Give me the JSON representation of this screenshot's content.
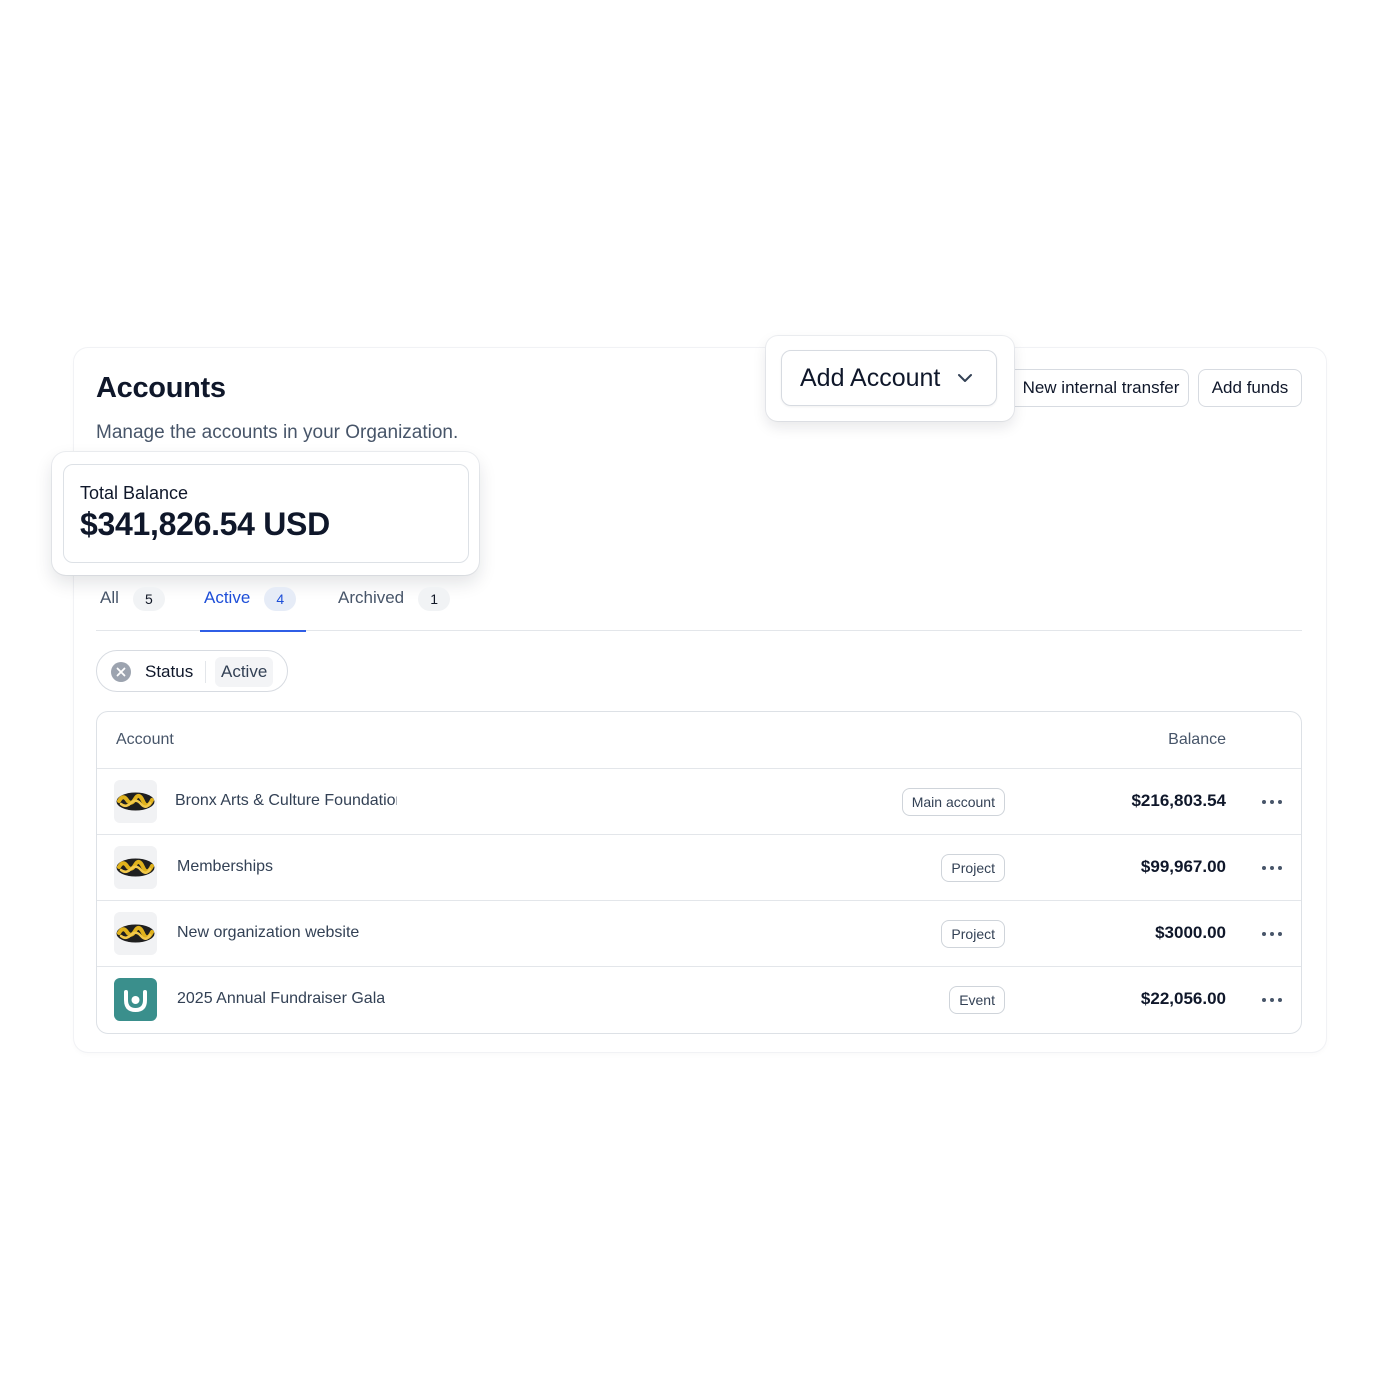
{
  "page": {
    "title": "Accounts",
    "subtitle": "Manage the accounts in your Organization."
  },
  "toolbar": {
    "add_account_label": "Add Account",
    "transfer_label": "New internal transfer",
    "add_funds_label": "Add funds"
  },
  "balance": {
    "label": "Total Balance",
    "value": "$341,826.54 USD"
  },
  "tabs": [
    {
      "label": "All",
      "count": "5",
      "selected": false
    },
    {
      "label": "Active",
      "count": "4",
      "selected": true
    },
    {
      "label": "Archived",
      "count": "1",
      "selected": false
    }
  ],
  "filter": {
    "key": "Status",
    "value": "Active"
  },
  "table": {
    "columns": {
      "account": "Account",
      "balance": "Balance"
    },
    "rows": [
      {
        "name": "Bronx Arts & Culture Foundation",
        "badge": "Main account",
        "balance": "$216,803.54",
        "avatar": "graffiti-logo"
      },
      {
        "name": "Memberships",
        "badge": "Project",
        "balance": "$99,967.00",
        "avatar": "graffiti-logo"
      },
      {
        "name": "New organization website",
        "badge": "Project",
        "balance": "$3000.00",
        "avatar": "graffiti-logo"
      },
      {
        "name": "2025 Annual Fundraiser Gala",
        "badge": "Event",
        "balance": "$22,056.00",
        "avatar": "smile-logo"
      }
    ]
  },
  "colors": {
    "accent": "#2f5ee6",
    "text": "#0f172a",
    "muted": "#475569",
    "border": "#dde1e6",
    "teal_avatar": "#3a8f8c"
  },
  "icons": {
    "dropdown": "chevron-down-icon",
    "clear_filter": "close-icon",
    "row_menu": "more-horizontal-icon"
  }
}
